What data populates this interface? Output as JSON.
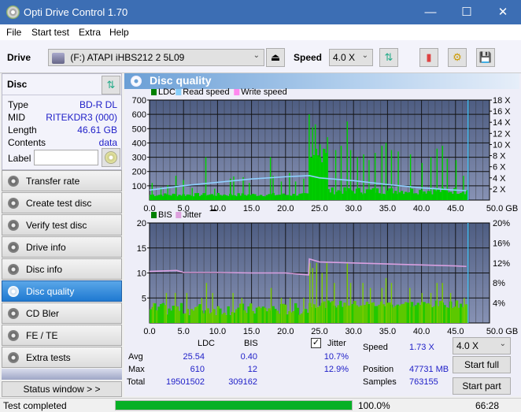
{
  "window": {
    "title": "Opti Drive Control 1.70",
    "minimize": "—",
    "maximize": "☐",
    "close": "✕"
  },
  "menu": [
    "File",
    "Start test",
    "Extra",
    "Help"
  ],
  "toolbar": {
    "drive_label": "Drive",
    "drive_value": "(F:)  ATAPI iHBS212   2 5L09",
    "speed_label": "Speed",
    "speed_value": "4.0 X"
  },
  "disc": {
    "title": "Disc",
    "rows": [
      {
        "k": "Type",
        "v": "BD-R DL"
      },
      {
        "k": "MID",
        "v": "RITEKDR3 (000)"
      },
      {
        "k": "Length",
        "v": "46.61 GB"
      },
      {
        "k": "Contents",
        "v": "data"
      }
    ],
    "label_key": "Label",
    "label_value": ""
  },
  "nav": [
    {
      "label": "Transfer rate",
      "active": false
    },
    {
      "label": "Create test disc",
      "active": false
    },
    {
      "label": "Verify test disc",
      "active": false
    },
    {
      "label": "Drive info",
      "active": false
    },
    {
      "label": "Disc info",
      "active": false
    },
    {
      "label": "Disc quality",
      "active": true
    },
    {
      "label": "CD Bler",
      "active": false
    },
    {
      "label": "FE / TE",
      "active": false
    },
    {
      "label": "Extra tests",
      "active": false
    }
  ],
  "status_window": "Status window > >",
  "panel_title": "Disc quality",
  "chart_data": [
    {
      "type": "bar",
      "title": "LDC / Read speed",
      "legend": [
        {
          "name": "LDC",
          "color": "#008000"
        },
        {
          "name": "Read speed",
          "color": "#87cefa"
        },
        {
          "name": "Write speed",
          "color": "#ff88ee"
        }
      ],
      "x_ticks": [
        "0.0",
        "5.0",
        "10.0",
        "15.0",
        "20.0",
        "25.0",
        "30.0",
        "35.0",
        "40.0",
        "45.0",
        "50.0 GB"
      ],
      "xlim": [
        0,
        50
      ],
      "y_ticks": [
        "100",
        "200",
        "300",
        "400",
        "500",
        "600",
        "700"
      ],
      "ylim": [
        0,
        700
      ],
      "y2_ticks": [
        "2 X",
        "4 X",
        "6 X",
        "8 X",
        "10 X",
        "12 X",
        "14 X",
        "16 X",
        "18 X"
      ],
      "y2lim": [
        0,
        18
      ],
      "ldc_peaks": [
        [
          0.3,
          120
        ],
        [
          1.6,
          90
        ],
        [
          2.6,
          105
        ],
        [
          3.8,
          170
        ],
        [
          4.9,
          140
        ],
        [
          6.2,
          85
        ],
        [
          8.2,
          300
        ],
        [
          9.5,
          80
        ],
        [
          11.8,
          150
        ],
        [
          12.3,
          165
        ],
        [
          13.7,
          160
        ],
        [
          14.6,
          120
        ],
        [
          17.7,
          300
        ],
        [
          18.1,
          170
        ],
        [
          19.3,
          130
        ],
        [
          20.5,
          190
        ],
        [
          21.4,
          130
        ],
        [
          22.6,
          150
        ],
        [
          23.4,
          600
        ],
        [
          23.9,
          510
        ],
        [
          24.3,
          530
        ],
        [
          25.0,
          390
        ],
        [
          25.5,
          360
        ],
        [
          26.1,
          440
        ],
        [
          27.3,
          350
        ],
        [
          28.1,
          380
        ],
        [
          29.0,
          550
        ],
        [
          29.5,
          350
        ],
        [
          30.5,
          300
        ],
        [
          31.4,
          320
        ],
        [
          32.2,
          280
        ],
        [
          33.1,
          330
        ],
        [
          34.1,
          380
        ],
        [
          34.7,
          400
        ],
        [
          35.5,
          350
        ],
        [
          36.5,
          340
        ],
        [
          38.3,
          320
        ],
        [
          40.0,
          260
        ],
        [
          41.3,
          300
        ],
        [
          42.2,
          360
        ],
        [
          43.0,
          380
        ],
        [
          43.7,
          290
        ],
        [
          45.0,
          280
        ],
        [
          46.1,
          170
        ]
      ],
      "read_speed": [
        [
          0,
          1.8
        ],
        [
          5,
          2.6
        ],
        [
          10,
          3.2
        ],
        [
          15,
          3.8
        ],
        [
          20,
          4.2
        ],
        [
          23.5,
          4.4
        ],
        [
          25,
          4.0
        ],
        [
          30,
          3.5
        ],
        [
          35,
          2.8
        ],
        [
          40,
          2.2
        ],
        [
          45,
          1.8
        ],
        [
          46.6,
          1.7
        ]
      ]
    },
    {
      "type": "bar",
      "title": "BIS / Jitter",
      "legend": [
        {
          "name": "BIS",
          "color": "#008000"
        },
        {
          "name": "Jitter",
          "color": "#dda0dd"
        }
      ],
      "x_ticks": [
        "0.0",
        "5.0",
        "10.0",
        "15.0",
        "20.0",
        "25.0",
        "30.0",
        "35.0",
        "40.0",
        "45.0",
        "50.0 GB"
      ],
      "xlim": [
        0,
        50
      ],
      "y_ticks": [
        "5",
        "10",
        "15",
        "20"
      ],
      "ylim": [
        0,
        20
      ],
      "y2_ticks": [
        "4%",
        "8%",
        "12%",
        "16%",
        "20%"
      ],
      "y2lim": [
        0,
        20
      ],
      "bis_peaks": [
        [
          0.5,
          4
        ],
        [
          2.4,
          6
        ],
        [
          3.7,
          6
        ],
        [
          5.4,
          6
        ],
        [
          7.6,
          5
        ],
        [
          8.3,
          8
        ],
        [
          9.2,
          6
        ],
        [
          12.2,
          6
        ],
        [
          13.5,
          5
        ],
        [
          17.8,
          7
        ],
        [
          19.3,
          5
        ],
        [
          20.6,
          5
        ],
        [
          22.6,
          5
        ],
        [
          23.5,
          12
        ],
        [
          23.9,
          11
        ],
        [
          24.5,
          12
        ],
        [
          25.3,
          10
        ],
        [
          26.0,
          12
        ],
        [
          27.1,
          8
        ],
        [
          29.0,
          12
        ],
        [
          29.5,
          8
        ],
        [
          31.3,
          8
        ],
        [
          32.4,
          7
        ],
        [
          34.1,
          7
        ],
        [
          34.7,
          9
        ],
        [
          35.5,
          8
        ],
        [
          38.2,
          7
        ],
        [
          40.0,
          6
        ],
        [
          41.3,
          6
        ],
        [
          42.2,
          8
        ],
        [
          43.0,
          8
        ],
        [
          44.2,
          6
        ],
        [
          46.2,
          5
        ]
      ],
      "jitter": [
        [
          0,
          10.3
        ],
        [
          4,
          10.5
        ],
        [
          5,
          10.1
        ],
        [
          10,
          10.1
        ],
        [
          15,
          10.0
        ],
        [
          20,
          10.0
        ],
        [
          23.4,
          9.6
        ],
        [
          23.5,
          12.8
        ],
        [
          25,
          12.2
        ],
        [
          30,
          12.0
        ],
        [
          35,
          11.8
        ],
        [
          40,
          11.6
        ],
        [
          45,
          11.4
        ],
        [
          46.6,
          11.3
        ]
      ]
    }
  ],
  "stats": {
    "headers": [
      "",
      "LDC",
      "BIS"
    ],
    "rows": [
      {
        "k": "Avg",
        "ldc": "25.54",
        "bis": "0.40",
        "jitter": "10.7%"
      },
      {
        "k": "Max",
        "ldc": "610",
        "bis": "12",
        "jitter": "12.9%"
      },
      {
        "k": "Total",
        "ldc": "19501502",
        "bis": "309162",
        "jitter": ""
      }
    ],
    "jitter_label": "Jitter",
    "jitter_checked": true,
    "speed_label": "Speed",
    "speed_value": "1.73 X",
    "position_label": "Position",
    "position_value": "47731 MB",
    "samples_label": "Samples",
    "samples_value": "763155",
    "speed_select": "4.0 X",
    "start_full": "Start full",
    "start_part": "Start part"
  },
  "statusbar": {
    "text": "Test completed",
    "progress": 1.0,
    "progress_text": "100.0%",
    "time": "66:28",
    "progress_color": "#06b025"
  }
}
